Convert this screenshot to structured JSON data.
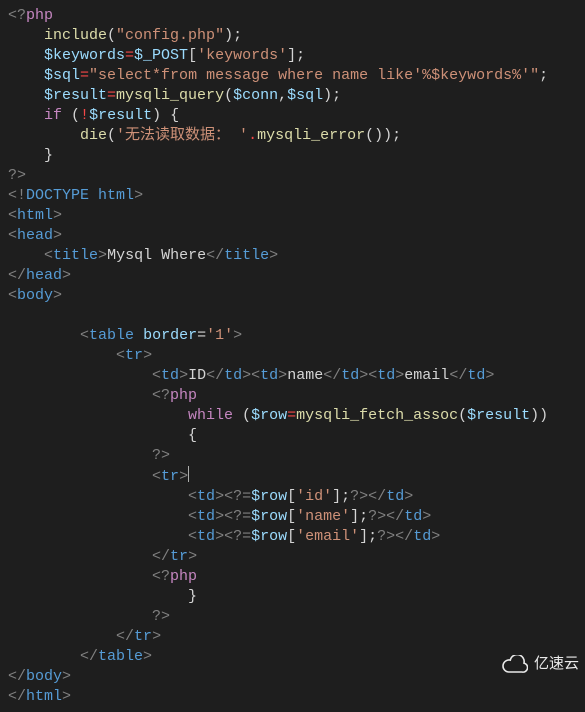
{
  "code": {
    "lines": [
      {
        "seg": [
          {
            "c": "punct",
            "t": "<?"
          },
          {
            "c": "keyword",
            "t": "php"
          }
        ]
      },
      {
        "seg": [
          {
            "c": "default",
            "t": "    "
          },
          {
            "c": "func",
            "t": "include"
          },
          {
            "c": "default",
            "t": "("
          },
          {
            "c": "string",
            "t": "\"config.php\""
          },
          {
            "c": "default",
            "t": ");"
          }
        ]
      },
      {
        "seg": [
          {
            "c": "default",
            "t": "    "
          },
          {
            "c": "var",
            "t": "$keywords"
          },
          {
            "c": "red",
            "t": "="
          },
          {
            "c": "var",
            "t": "$_POST"
          },
          {
            "c": "default",
            "t": "["
          },
          {
            "c": "string",
            "t": "'keywords'"
          },
          {
            "c": "default",
            "t": "];"
          }
        ]
      },
      {
        "seg": [
          {
            "c": "default",
            "t": "    "
          },
          {
            "c": "var",
            "t": "$sql"
          },
          {
            "c": "red",
            "t": "="
          },
          {
            "c": "string",
            "t": "\"select*from message where name like'%$keywords%'\""
          },
          {
            "c": "default",
            "t": ";"
          }
        ]
      },
      {
        "seg": [
          {
            "c": "default",
            "t": "    "
          },
          {
            "c": "var",
            "t": "$result"
          },
          {
            "c": "red",
            "t": "="
          },
          {
            "c": "func",
            "t": "mysqli_query"
          },
          {
            "c": "default",
            "t": "("
          },
          {
            "c": "var",
            "t": "$conn"
          },
          {
            "c": "default",
            "t": ","
          },
          {
            "c": "var",
            "t": "$sql"
          },
          {
            "c": "default",
            "t": ");"
          }
        ]
      },
      {
        "seg": [
          {
            "c": "default",
            "t": "    "
          },
          {
            "c": "keyword",
            "t": "if"
          },
          {
            "c": "default",
            "t": " ("
          },
          {
            "c": "red",
            "t": "!"
          },
          {
            "c": "var",
            "t": "$result"
          },
          {
            "c": "default",
            "t": ") {"
          }
        ]
      },
      {
        "seg": [
          {
            "c": "default",
            "t": "        "
          },
          {
            "c": "func",
            "t": "die"
          },
          {
            "c": "default",
            "t": "("
          },
          {
            "c": "string",
            "t": "'无法读取数据： '"
          },
          {
            "c": "red",
            "t": "."
          },
          {
            "c": "func",
            "t": "mysqli_error"
          },
          {
            "c": "default",
            "t": "());"
          }
        ]
      },
      {
        "seg": [
          {
            "c": "default",
            "t": "    }"
          }
        ]
      },
      {
        "seg": [
          {
            "c": "punct",
            "t": "?>"
          }
        ]
      },
      {
        "seg": [
          {
            "c": "punct",
            "t": "<!"
          },
          {
            "c": "doctype",
            "t": "DOCTYPE"
          },
          {
            "c": "default",
            "t": " "
          },
          {
            "c": "tag",
            "t": "html"
          },
          {
            "c": "punct",
            "t": ">"
          }
        ]
      },
      {
        "seg": [
          {
            "c": "punct",
            "t": "<"
          },
          {
            "c": "tag",
            "t": "html"
          },
          {
            "c": "punct",
            "t": ">"
          }
        ]
      },
      {
        "seg": [
          {
            "c": "punct",
            "t": "<"
          },
          {
            "c": "tag",
            "t": "head"
          },
          {
            "c": "punct",
            "t": ">"
          }
        ]
      },
      {
        "seg": [
          {
            "c": "default",
            "t": "    "
          },
          {
            "c": "punct",
            "t": "<"
          },
          {
            "c": "tag",
            "t": "title"
          },
          {
            "c": "punct",
            "t": ">"
          },
          {
            "c": "default",
            "t": "Mysql Where"
          },
          {
            "c": "punct",
            "t": "</"
          },
          {
            "c": "tag",
            "t": "title"
          },
          {
            "c": "punct",
            "t": ">"
          }
        ]
      },
      {
        "seg": [
          {
            "c": "punct",
            "t": "</"
          },
          {
            "c": "tag",
            "t": "head"
          },
          {
            "c": "punct",
            "t": ">"
          }
        ]
      },
      {
        "seg": [
          {
            "c": "punct",
            "t": "<"
          },
          {
            "c": "tag",
            "t": "body"
          },
          {
            "c": "punct",
            "t": ">"
          }
        ]
      },
      {
        "seg": [
          {
            "c": "default",
            "t": ""
          }
        ]
      },
      {
        "seg": [
          {
            "c": "default",
            "t": "        "
          },
          {
            "c": "punct",
            "t": "<"
          },
          {
            "c": "tag",
            "t": "table"
          },
          {
            "c": "default",
            "t": " "
          },
          {
            "c": "attr",
            "t": "border"
          },
          {
            "c": "default",
            "t": "="
          },
          {
            "c": "string",
            "t": "'1'"
          },
          {
            "c": "punct",
            "t": ">"
          }
        ]
      },
      {
        "seg": [
          {
            "c": "default",
            "t": "            "
          },
          {
            "c": "punct",
            "t": "<"
          },
          {
            "c": "tag",
            "t": "tr"
          },
          {
            "c": "punct",
            "t": ">"
          }
        ]
      },
      {
        "seg": [
          {
            "c": "default",
            "t": "                "
          },
          {
            "c": "punct",
            "t": "<"
          },
          {
            "c": "tag",
            "t": "td"
          },
          {
            "c": "punct",
            "t": ">"
          },
          {
            "c": "default",
            "t": "ID"
          },
          {
            "c": "punct",
            "t": "</"
          },
          {
            "c": "tag",
            "t": "td"
          },
          {
            "c": "punct",
            "t": ">"
          },
          {
            "c": "punct",
            "t": "<"
          },
          {
            "c": "tag",
            "t": "td"
          },
          {
            "c": "punct",
            "t": ">"
          },
          {
            "c": "default",
            "t": "name"
          },
          {
            "c": "punct",
            "t": "</"
          },
          {
            "c": "tag",
            "t": "td"
          },
          {
            "c": "punct",
            "t": ">"
          },
          {
            "c": "punct",
            "t": "<"
          },
          {
            "c": "tag",
            "t": "td"
          },
          {
            "c": "punct",
            "t": ">"
          },
          {
            "c": "default",
            "t": "email"
          },
          {
            "c": "punct",
            "t": "</"
          },
          {
            "c": "tag",
            "t": "td"
          },
          {
            "c": "punct",
            "t": ">"
          }
        ]
      },
      {
        "seg": [
          {
            "c": "default",
            "t": "                "
          },
          {
            "c": "punct",
            "t": "<?"
          },
          {
            "c": "keyword",
            "t": "php"
          }
        ]
      },
      {
        "seg": [
          {
            "c": "default",
            "t": "                    "
          },
          {
            "c": "keyword",
            "t": "while"
          },
          {
            "c": "default",
            "t": " ("
          },
          {
            "c": "var",
            "t": "$row"
          },
          {
            "c": "red",
            "t": "="
          },
          {
            "c": "func",
            "t": "mysqli_fetch_assoc"
          },
          {
            "c": "default",
            "t": "("
          },
          {
            "c": "var",
            "t": "$result"
          },
          {
            "c": "default",
            "t": "))"
          }
        ]
      },
      {
        "seg": [
          {
            "c": "default",
            "t": "                    {"
          }
        ]
      },
      {
        "seg": [
          {
            "c": "default",
            "t": "                "
          },
          {
            "c": "punct",
            "t": "?>"
          }
        ]
      },
      {
        "seg": [
          {
            "c": "default",
            "t": "                "
          },
          {
            "c": "punct",
            "t": "<"
          },
          {
            "c": "tag",
            "t": "tr"
          },
          {
            "c": "punct",
            "t": ">"
          },
          {
            "c": "cursor",
            "t": ""
          }
        ]
      },
      {
        "seg": [
          {
            "c": "default",
            "t": "                    "
          },
          {
            "c": "punct",
            "t": "<"
          },
          {
            "c": "tag",
            "t": "td"
          },
          {
            "c": "punct",
            "t": ">"
          },
          {
            "c": "punct",
            "t": "<?="
          },
          {
            "c": "var",
            "t": "$row"
          },
          {
            "c": "default",
            "t": "["
          },
          {
            "c": "string",
            "t": "'id'"
          },
          {
            "c": "default",
            "t": "];"
          },
          {
            "c": "punct",
            "t": "?>"
          },
          {
            "c": "punct",
            "t": "</"
          },
          {
            "c": "tag",
            "t": "td"
          },
          {
            "c": "punct",
            "t": ">"
          }
        ]
      },
      {
        "seg": [
          {
            "c": "default",
            "t": "                    "
          },
          {
            "c": "punct",
            "t": "<"
          },
          {
            "c": "tag",
            "t": "td"
          },
          {
            "c": "punct",
            "t": ">"
          },
          {
            "c": "punct",
            "t": "<?="
          },
          {
            "c": "var",
            "t": "$row"
          },
          {
            "c": "default",
            "t": "["
          },
          {
            "c": "string",
            "t": "'name'"
          },
          {
            "c": "default",
            "t": "];"
          },
          {
            "c": "punct",
            "t": "?>"
          },
          {
            "c": "punct",
            "t": "</"
          },
          {
            "c": "tag",
            "t": "td"
          },
          {
            "c": "punct",
            "t": ">"
          }
        ]
      },
      {
        "seg": [
          {
            "c": "default",
            "t": "                    "
          },
          {
            "c": "punct",
            "t": "<"
          },
          {
            "c": "tag",
            "t": "td"
          },
          {
            "c": "punct",
            "t": ">"
          },
          {
            "c": "punct",
            "t": "<?="
          },
          {
            "c": "var",
            "t": "$row"
          },
          {
            "c": "default",
            "t": "["
          },
          {
            "c": "string",
            "t": "'email'"
          },
          {
            "c": "default",
            "t": "];"
          },
          {
            "c": "punct",
            "t": "?>"
          },
          {
            "c": "punct",
            "t": "</"
          },
          {
            "c": "tag",
            "t": "td"
          },
          {
            "c": "punct",
            "t": ">"
          }
        ]
      },
      {
        "seg": [
          {
            "c": "default",
            "t": "                "
          },
          {
            "c": "punct",
            "t": "</"
          },
          {
            "c": "tag",
            "t": "tr"
          },
          {
            "c": "punct",
            "t": ">"
          }
        ]
      },
      {
        "seg": [
          {
            "c": "default",
            "t": "                "
          },
          {
            "c": "punct",
            "t": "<?"
          },
          {
            "c": "keyword",
            "t": "php"
          }
        ]
      },
      {
        "seg": [
          {
            "c": "default",
            "t": "                    }"
          }
        ]
      },
      {
        "seg": [
          {
            "c": "default",
            "t": "                "
          },
          {
            "c": "punct",
            "t": "?>"
          }
        ]
      },
      {
        "seg": [
          {
            "c": "default",
            "t": "            "
          },
          {
            "c": "punct",
            "t": "</"
          },
          {
            "c": "tag",
            "t": "tr"
          },
          {
            "c": "punct",
            "t": ">"
          }
        ]
      },
      {
        "seg": [
          {
            "c": "default",
            "t": "        "
          },
          {
            "c": "punct",
            "t": "</"
          },
          {
            "c": "tag",
            "t": "table"
          },
          {
            "c": "punct",
            "t": ">"
          }
        ]
      },
      {
        "seg": [
          {
            "c": "punct",
            "t": "</"
          },
          {
            "c": "tag",
            "t": "body"
          },
          {
            "c": "punct",
            "t": ">"
          }
        ]
      },
      {
        "seg": [
          {
            "c": "punct",
            "t": "</"
          },
          {
            "c": "tag",
            "t": "html"
          },
          {
            "c": "punct",
            "t": ">"
          }
        ]
      }
    ]
  },
  "watermark": {
    "text": "亿速云"
  }
}
